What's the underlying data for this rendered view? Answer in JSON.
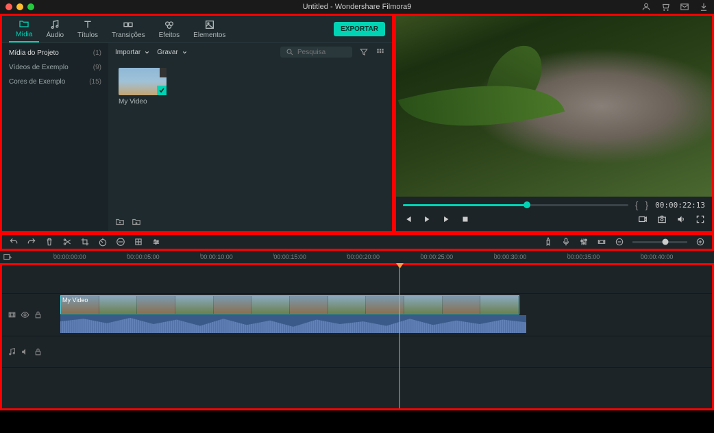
{
  "titlebar": {
    "title": "Untitled - Wondershare Filmora9"
  },
  "tabs": {
    "media": "Mídia",
    "audio": "Áudio",
    "titles": "Títulos",
    "transitions": "Transições",
    "effects": "Efeitos",
    "elements": "Elementos"
  },
  "export_label": "EXPORTAR",
  "sidebar": {
    "items": [
      {
        "label": "Mídia do Projeto",
        "count": "(1)"
      },
      {
        "label": "Vídeos de Exemplo",
        "count": "(9)"
      },
      {
        "label": "Cores de Exemplo",
        "count": "(15)"
      }
    ]
  },
  "media_toolbar": {
    "import": "Importar",
    "record": "Gravar",
    "search_placeholder": "Pesquisa"
  },
  "media_items": [
    {
      "label": "My Video"
    }
  ],
  "preview": {
    "timecode": "00:00:22:13"
  },
  "ruler": [
    "00:00:00:00",
    "00:00:05:00",
    "00:00:10:00",
    "00:00:15:00",
    "00:00:20:00",
    "00:00:25:00",
    "00:00:30:00",
    "00:00:35:00",
    "00:00:40:00"
  ],
  "timeline": {
    "clip_label": "My Video"
  }
}
